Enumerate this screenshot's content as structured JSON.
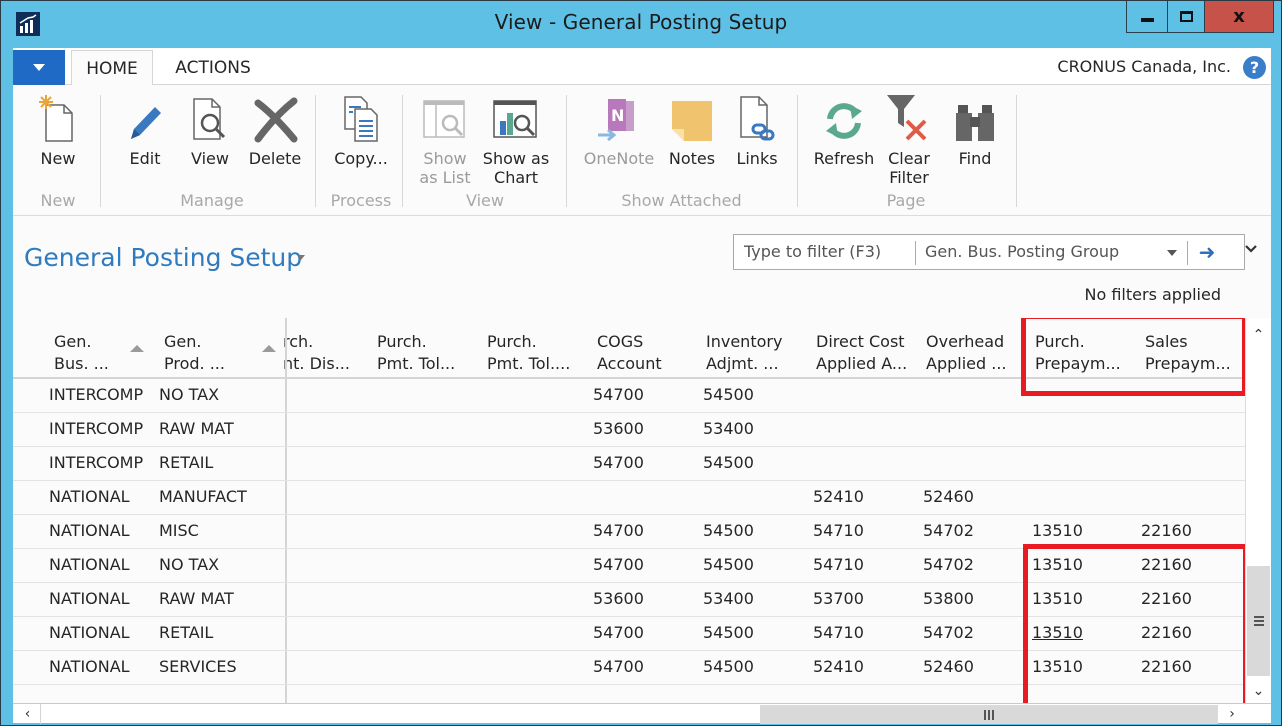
{
  "window": {
    "title": "View - General Posting Setup",
    "controls": {
      "minimize": "minimize",
      "maximize": "maximize",
      "close": "x"
    }
  },
  "ribbon_tabs": [
    {
      "label": "HOME",
      "active": true
    },
    {
      "label": "ACTIONS",
      "active": false
    }
  ],
  "company": "CRONUS Canada, Inc.",
  "help_glyph": "?",
  "ribbon": {
    "groups": [
      {
        "label": "New",
        "buttons": [
          {
            "label": "New",
            "icon": "new-document-icon",
            "enabled": true
          }
        ]
      },
      {
        "label": "Manage",
        "buttons": [
          {
            "label": "Edit",
            "icon": "pencil-icon",
            "enabled": true
          },
          {
            "label": "View",
            "icon": "view-document-icon",
            "enabled": true
          },
          {
            "label": "Delete",
            "icon": "delete-x-icon",
            "enabled": true
          }
        ]
      },
      {
        "label": "Process",
        "buttons": [
          {
            "label": "Copy...",
            "icon": "copy-icon",
            "enabled": true
          }
        ]
      },
      {
        "label": "View",
        "buttons": [
          {
            "label": "Show as List",
            "line1": "Show",
            "line2": "as List",
            "icon": "list-view-icon",
            "enabled": false
          },
          {
            "label": "Show as Chart",
            "line1": "Show as",
            "line2": "Chart",
            "icon": "chart-view-icon",
            "enabled": true
          }
        ]
      },
      {
        "label": "Show Attached",
        "buttons": [
          {
            "label": "OneNote",
            "icon": "onenote-icon",
            "enabled": false
          },
          {
            "label": "Notes",
            "icon": "notes-icon",
            "enabled": true
          },
          {
            "label": "Links",
            "icon": "links-icon",
            "enabled": true
          }
        ]
      },
      {
        "label": "Page",
        "buttons": [
          {
            "label": "Refresh",
            "icon": "refresh-icon",
            "enabled": true
          },
          {
            "label": "Clear Filter",
            "line1": "Clear",
            "line2": "Filter",
            "icon": "clear-filter-icon",
            "enabled": true
          },
          {
            "label": "Find",
            "icon": "binoculars-icon",
            "enabled": true
          }
        ]
      }
    ]
  },
  "page": {
    "title": "General Posting Setup",
    "filter": {
      "placeholder": "Type to filter (F3)",
      "field": "Gen. Bus. Posting Group",
      "status": "No filters applied"
    }
  },
  "grid": {
    "columns": [
      {
        "line1": "Gen.",
        "line2": "Bus. ...",
        "sorted": "asc"
      },
      {
        "line1": "Gen.",
        "line2": "Prod. ...",
        "sorted": "asc"
      },
      {
        "line1": "rch.",
        "line2": "nt. Dis..."
      },
      {
        "line1": "Purch.",
        "line2": "Pmt. Tol..."
      },
      {
        "line1": "Purch.",
        "line2": "Pmt. Tol...."
      },
      {
        "line1": "COGS",
        "line2": "Account"
      },
      {
        "line1": "Inventory",
        "line2": "Adjmt. ..."
      },
      {
        "line1": "Direct Cost",
        "line2": "Applied A..."
      },
      {
        "line1": "Overhead",
        "line2": "Applied ..."
      },
      {
        "line1": "Purch.",
        "line2": "Prepaym..."
      },
      {
        "line1": "Sales",
        "line2": "Prepaym..."
      }
    ],
    "rows": [
      {
        "bus": "INTERCOMP",
        "prod": "NO TAX",
        "cogs": "54700",
        "inv": "54500",
        "direct": "",
        "overhead": "",
        "purch_prepay": "",
        "sales_prepay": ""
      },
      {
        "bus": "INTERCOMP",
        "prod": "RAW MAT",
        "cogs": "53600",
        "inv": "53400",
        "direct": "",
        "overhead": "",
        "purch_prepay": "",
        "sales_prepay": ""
      },
      {
        "bus": "INTERCOMP",
        "prod": "RETAIL",
        "cogs": "54700",
        "inv": "54500",
        "direct": "",
        "overhead": "",
        "purch_prepay": "",
        "sales_prepay": ""
      },
      {
        "bus": "NATIONAL",
        "prod": "MANUFACT",
        "cogs": "",
        "inv": "",
        "direct": "52410",
        "overhead": "52460",
        "purch_prepay": "",
        "sales_prepay": ""
      },
      {
        "bus": "NATIONAL",
        "prod": "MISC",
        "cogs": "54700",
        "inv": "54500",
        "direct": "54710",
        "overhead": "54702",
        "purch_prepay": "13510",
        "sales_prepay": "22160"
      },
      {
        "bus": "NATIONAL",
        "prod": "NO TAX",
        "cogs": "54700",
        "inv": "54500",
        "direct": "54710",
        "overhead": "54702",
        "purch_prepay": "13510",
        "sales_prepay": "22160"
      },
      {
        "bus": "NATIONAL",
        "prod": "RAW MAT",
        "cogs": "53600",
        "inv": "53400",
        "direct": "53700",
        "overhead": "53800",
        "purch_prepay": "13510",
        "sales_prepay": "22160"
      },
      {
        "bus": "NATIONAL",
        "prod": "RETAIL",
        "cogs": "54700",
        "inv": "54500",
        "direct": "54710",
        "overhead": "54702",
        "purch_prepay": "13510",
        "sales_prepay": "22160",
        "focused": true
      },
      {
        "bus": "NATIONAL",
        "prod": "SERVICES",
        "cogs": "54700",
        "inv": "54500",
        "direct": "52410",
        "overhead": "52460",
        "purch_prepay": "13510",
        "sales_prepay": "22160"
      }
    ]
  },
  "highlight_color": "#e81b23"
}
